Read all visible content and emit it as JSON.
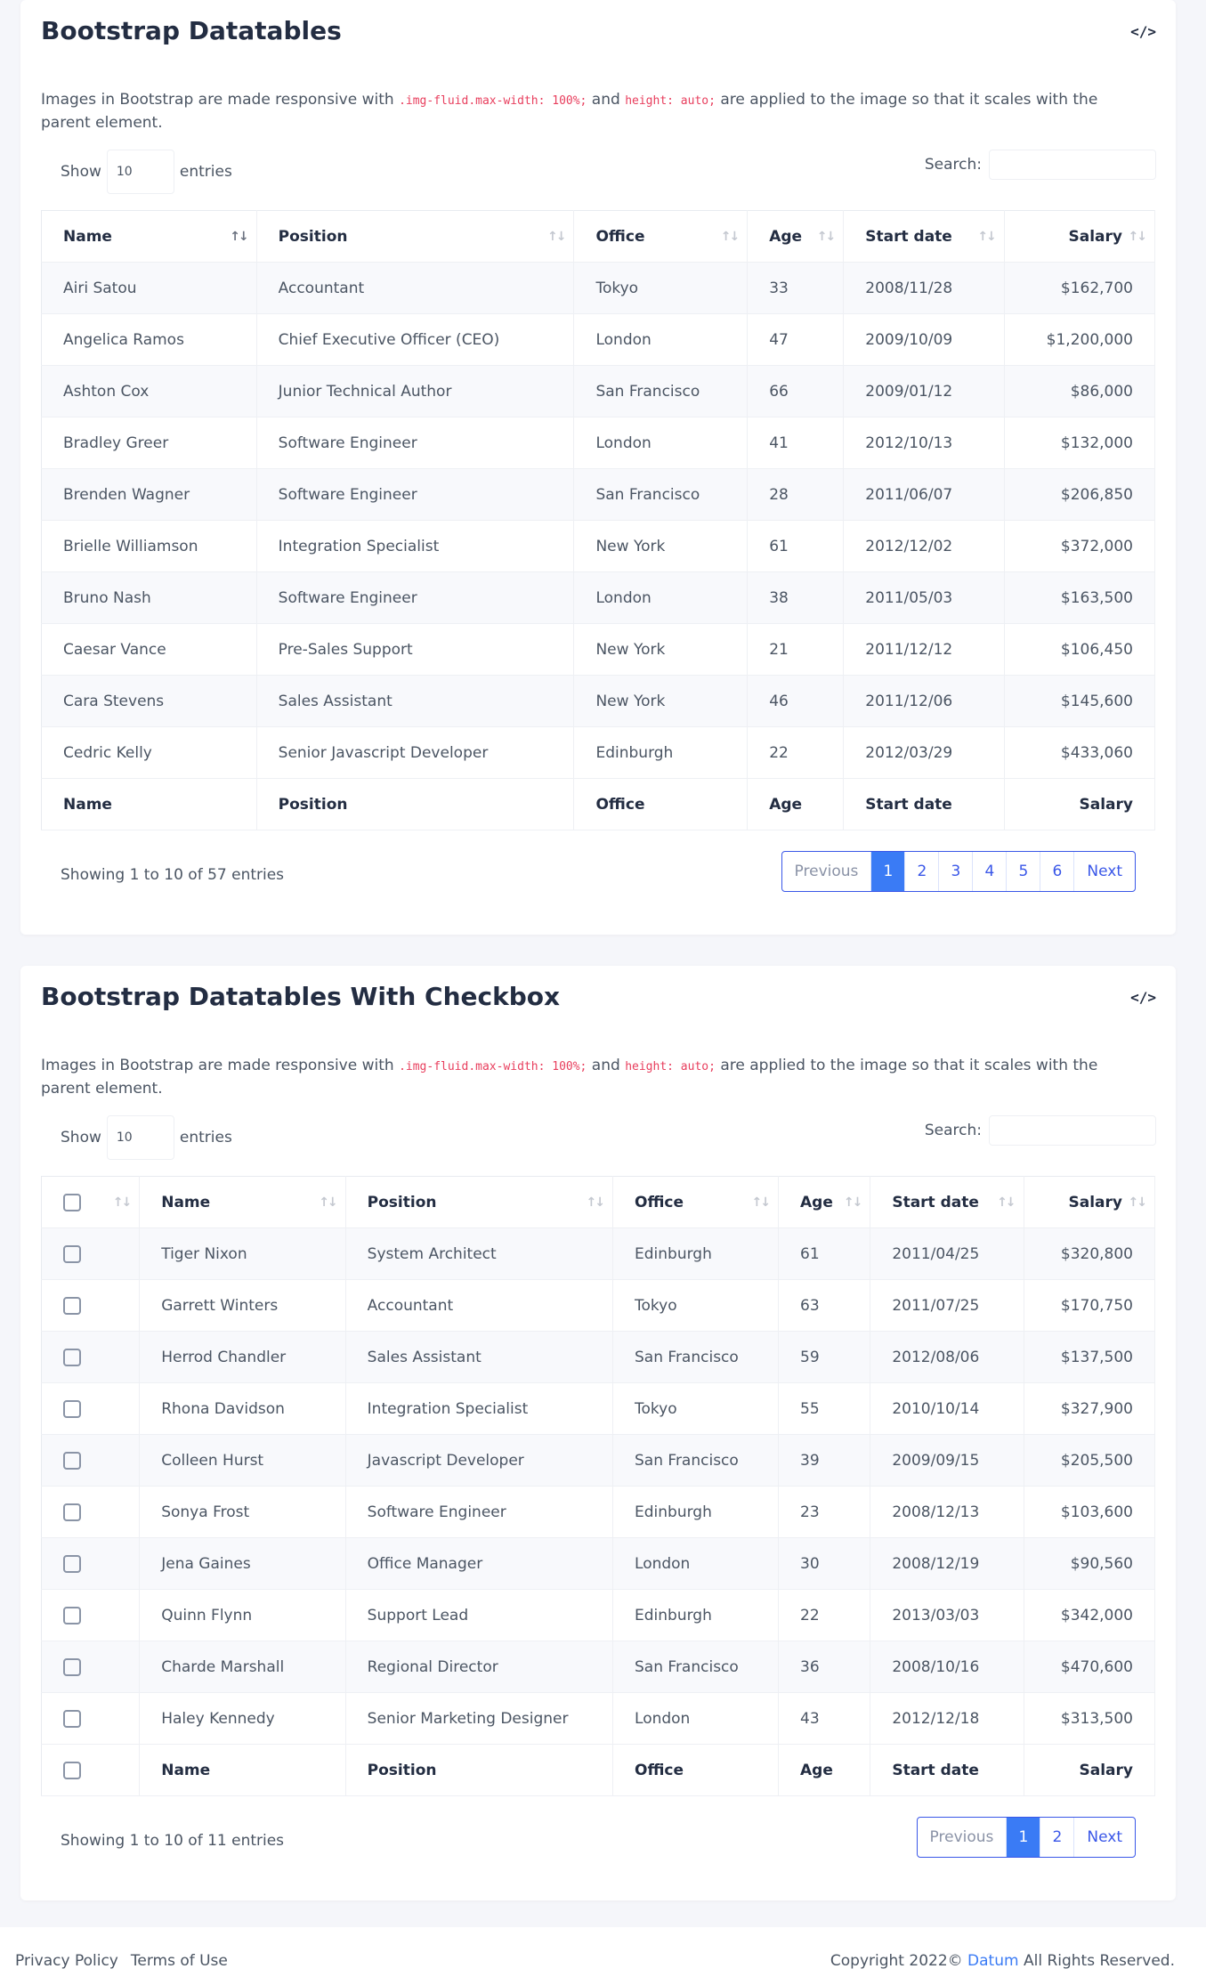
{
  "section1": {
    "title": "Bootstrap Datatables",
    "code_toggle": "</>",
    "desc_before": "Images in Bootstrap are made responsive with ",
    "desc_code1": ".img-fluid.",
    "desc_code2": "max-width: 100%;",
    "desc_middle": " and ",
    "desc_code3": "height: auto;",
    "desc_after": " are applied to the image so that it scales with the parent element.",
    "show_label": "Show",
    "entries_label": "entries",
    "length_value": "10",
    "search_label": "Search:",
    "columns": [
      "Name",
      "Position",
      "Office",
      "Age",
      "Start date",
      "Salary"
    ],
    "rows": [
      [
        "Airi Satou",
        "Accountant",
        "Tokyo",
        "33",
        "2008/11/28",
        "$162,700"
      ],
      [
        "Angelica Ramos",
        "Chief Executive Officer (CEO)",
        "London",
        "47",
        "2009/10/09",
        "$1,200,000"
      ],
      [
        "Ashton Cox",
        "Junior Technical Author",
        "San Francisco",
        "66",
        "2009/01/12",
        "$86,000"
      ],
      [
        "Bradley Greer",
        "Software Engineer",
        "London",
        "41",
        "2012/10/13",
        "$132,000"
      ],
      [
        "Brenden Wagner",
        "Software Engineer",
        "San Francisco",
        "28",
        "2011/06/07",
        "$206,850"
      ],
      [
        "Brielle Williamson",
        "Integration Specialist",
        "New York",
        "61",
        "2012/12/02",
        "$372,000"
      ],
      [
        "Bruno Nash",
        "Software Engineer",
        "London",
        "38",
        "2011/05/03",
        "$163,500"
      ],
      [
        "Caesar Vance",
        "Pre-Sales Support",
        "New York",
        "21",
        "2011/12/12",
        "$106,450"
      ],
      [
        "Cara Stevens",
        "Sales Assistant",
        "New York",
        "46",
        "2011/12/06",
        "$145,600"
      ],
      [
        "Cedric Kelly",
        "Senior Javascript Developer",
        "Edinburgh",
        "22",
        "2012/03/29",
        "$433,060"
      ]
    ],
    "info": "Showing 1 to 10 of 57 entries",
    "pager": {
      "prev": "Previous",
      "pages": [
        "1",
        "2",
        "3",
        "4",
        "5",
        "6"
      ],
      "next": "Next",
      "active": "1"
    }
  },
  "section2": {
    "title": "Bootstrap Datatables With Checkbox",
    "code_toggle": "</>",
    "desc_before": "Images in Bootstrap are made responsive with ",
    "desc_code1": ".img-fluid.",
    "desc_code2": "max-width: 100%;",
    "desc_middle": " and ",
    "desc_code3": "height: auto;",
    "desc_after": " are applied to the image so that it scales with the parent element.",
    "show_label": "Show",
    "entries_label": "entries",
    "length_value": "10",
    "search_label": "Search:",
    "columns": [
      "Name",
      "Position",
      "Office",
      "Age",
      "Start date",
      "Salary"
    ],
    "rows": [
      [
        "Tiger Nixon",
        "System Architect",
        "Edinburgh",
        "61",
        "2011/04/25",
        "$320,800"
      ],
      [
        "Garrett Winters",
        "Accountant",
        "Tokyo",
        "63",
        "2011/07/25",
        "$170,750"
      ],
      [
        "Herrod Chandler",
        "Sales Assistant",
        "San Francisco",
        "59",
        "2012/08/06",
        "$137,500"
      ],
      [
        "Rhona Davidson",
        "Integration Specialist",
        "Tokyo",
        "55",
        "2010/10/14",
        "$327,900"
      ],
      [
        "Colleen Hurst",
        "Javascript Developer",
        "San Francisco",
        "39",
        "2009/09/15",
        "$205,500"
      ],
      [
        "Sonya Frost",
        "Software Engineer",
        "Edinburgh",
        "23",
        "2008/12/13",
        "$103,600"
      ],
      [
        "Jena Gaines",
        "Office Manager",
        "London",
        "30",
        "2008/12/19",
        "$90,560"
      ],
      [
        "Quinn Flynn",
        "Support Lead",
        "Edinburgh",
        "22",
        "2013/03/03",
        "$342,000"
      ],
      [
        "Charde Marshall",
        "Regional Director",
        "San Francisco",
        "36",
        "2008/10/16",
        "$470,600"
      ],
      [
        "Haley Kennedy",
        "Senior Marketing Designer",
        "London",
        "43",
        "2012/12/18",
        "$313,500"
      ]
    ],
    "info": "Showing 1 to 10 of 11 entries",
    "pager": {
      "prev": "Previous",
      "pages": [
        "1",
        "2"
      ],
      "next": "Next",
      "active": "1"
    }
  },
  "footer": {
    "privacy": "Privacy Policy",
    "terms": "Terms of Use",
    "copy_before": "Copyright 2022© ",
    "brand": "Datum",
    "copy_after": " All Rights Reserved."
  },
  "colors": {
    "accent": "#3a7bf5",
    "code": "#e83e5d",
    "heading": "#232d42"
  },
  "icons": {
    "code_toggle": "code-icon",
    "sort": "sort-arrows-icon",
    "sort_asc": "sort-ascending-icon",
    "checkbox": "checkbox-icon"
  }
}
